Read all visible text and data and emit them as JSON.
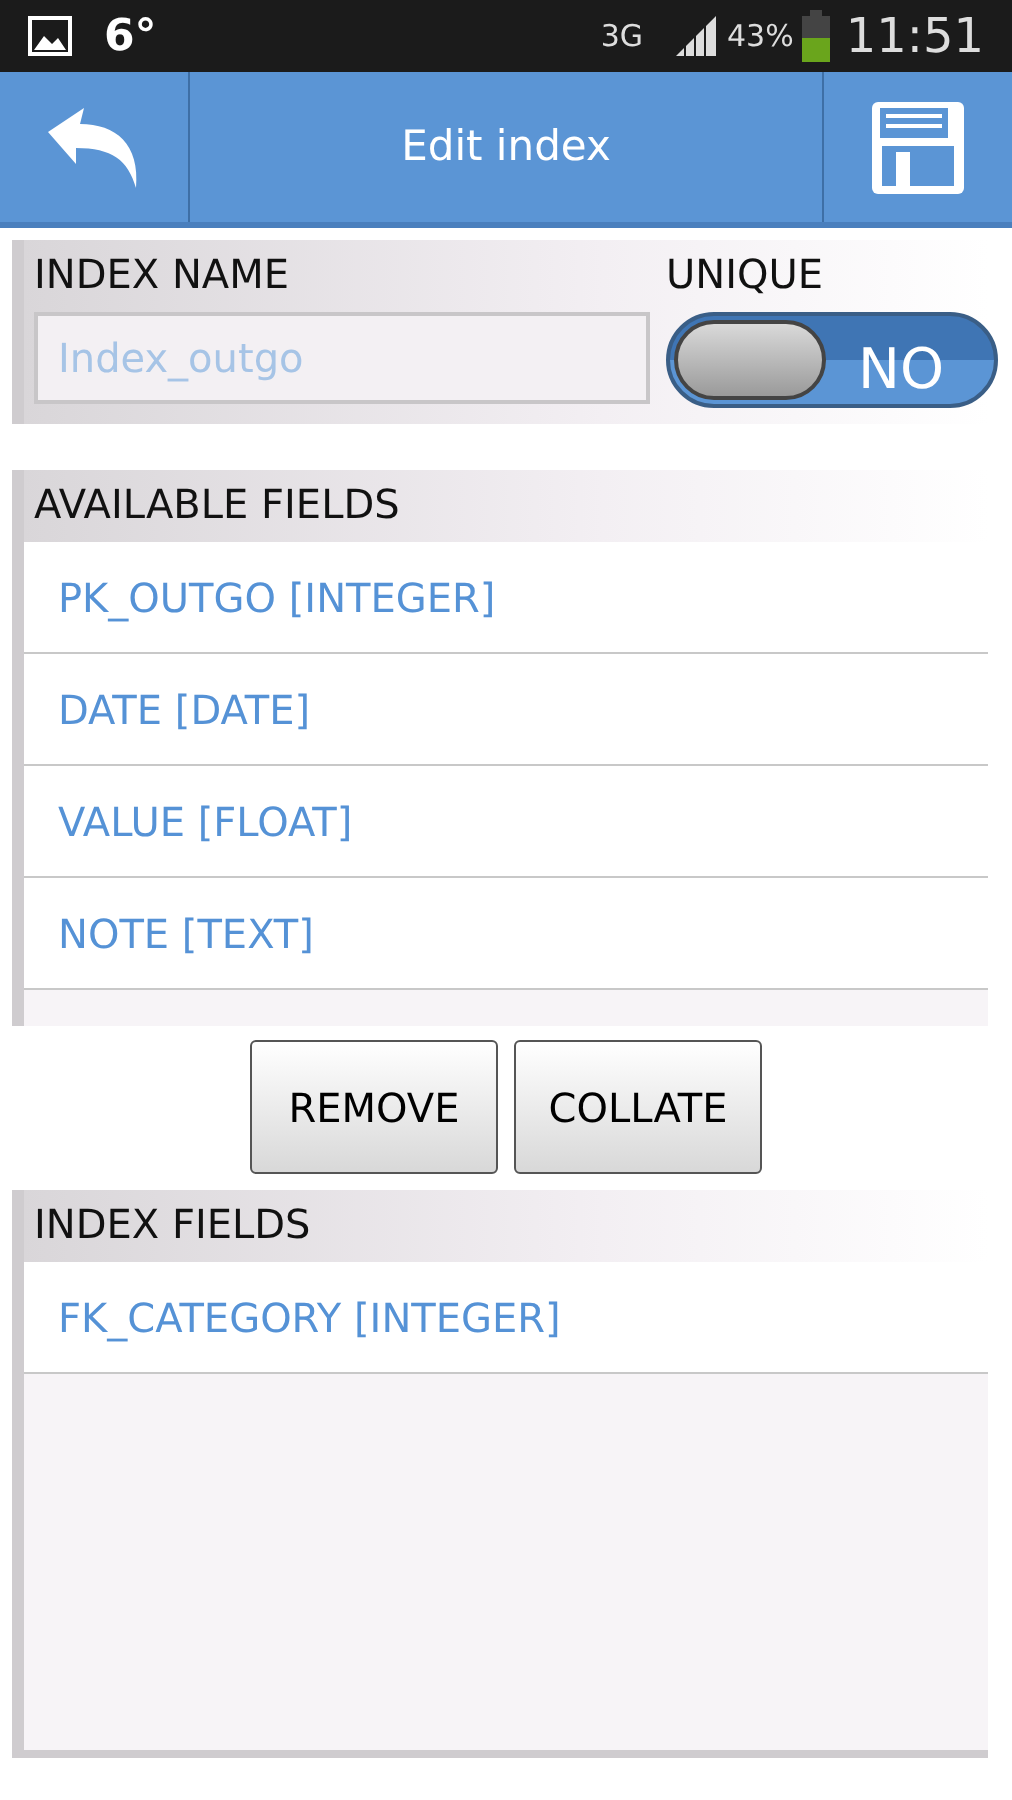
{
  "status_bar": {
    "temperature": "6°",
    "network": "3G",
    "battery": "43%",
    "time": "11:51"
  },
  "header": {
    "title": "Edit index"
  },
  "index_name": {
    "label": "INDEX NAME",
    "value": "Index_outgo"
  },
  "unique": {
    "label": "UNIQUE",
    "on": false,
    "text": "NO"
  },
  "available_fields": {
    "title": "AVAILABLE FIELDS",
    "items": [
      {
        "label": "PK_OUTGO [INTEGER]"
      },
      {
        "label": "DATE [DATE]"
      },
      {
        "label": "VALUE [FLOAT]"
      },
      {
        "label": "NOTE [TEXT]"
      }
    ]
  },
  "buttons": [
    "REMOVE",
    "COLLATE"
  ],
  "index_fields": {
    "title": "INDEX FIELDS",
    "items": [
      {
        "label": "FK_CATEGORY [INTEGER]"
      }
    ]
  }
}
